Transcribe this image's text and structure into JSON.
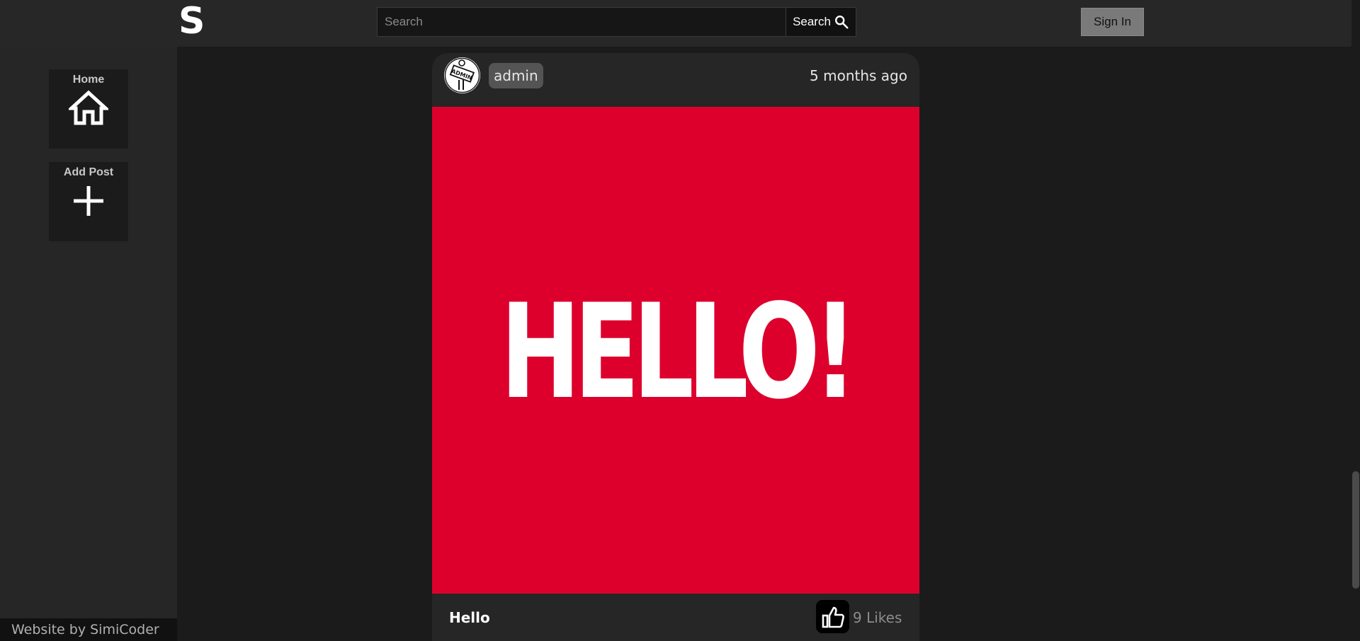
{
  "header": {
    "logo_text": "S",
    "search": {
      "placeholder": "Search",
      "button_label": "Search"
    },
    "sign_in_label": "Sign In"
  },
  "sidebar": {
    "items": [
      {
        "label": "Home",
        "icon": "home-icon"
      },
      {
        "label": "Add Post",
        "icon": "plus-icon"
      }
    ],
    "footer_credit": "Website by SimiCoder"
  },
  "post": {
    "username": "admin",
    "avatar_badge_text": "ADMIN",
    "timestamp": "5 months ago",
    "image_text": "HELLO!",
    "image_background": "#dd002d",
    "title": "Hello",
    "likes_label": "9 Likes",
    "like_icon": "thumbs-up-icon"
  },
  "theme": {
    "page_background": "#1b1b1b",
    "bar_background": "#272727",
    "accent": "#dd002d"
  }
}
